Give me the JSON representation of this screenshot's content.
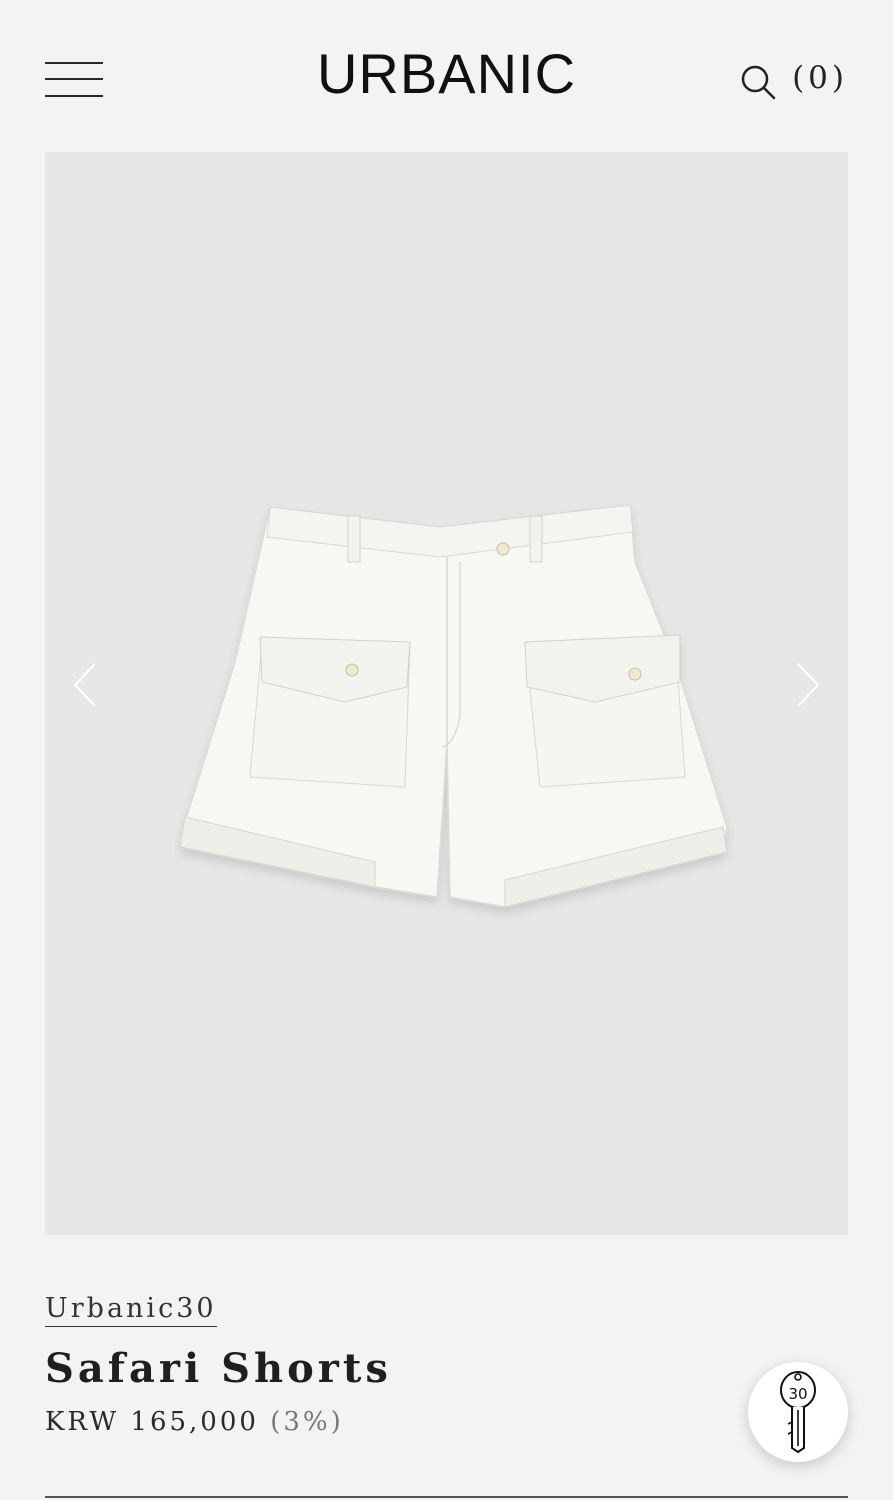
{
  "header": {
    "logo": "URBANIC",
    "cart_count": "(0)",
    "menu_icon": "hamburger-menu-icon",
    "search_icon": "search-icon"
  },
  "gallery": {
    "prev_icon": "chevron-left-icon",
    "next_icon": "chevron-right-icon",
    "image_subject": "white safari shorts"
  },
  "product": {
    "collection": "Urbanic30",
    "title": "Safari Shorts",
    "price": "KRW 165,000",
    "discount": "(3%)"
  },
  "fab": {
    "icon": "key-30-icon",
    "label": "30"
  },
  "colors": {
    "background": "#f3f3f3",
    "gallery_bg": "#e7e7e7",
    "text": "#1a1a1a"
  }
}
